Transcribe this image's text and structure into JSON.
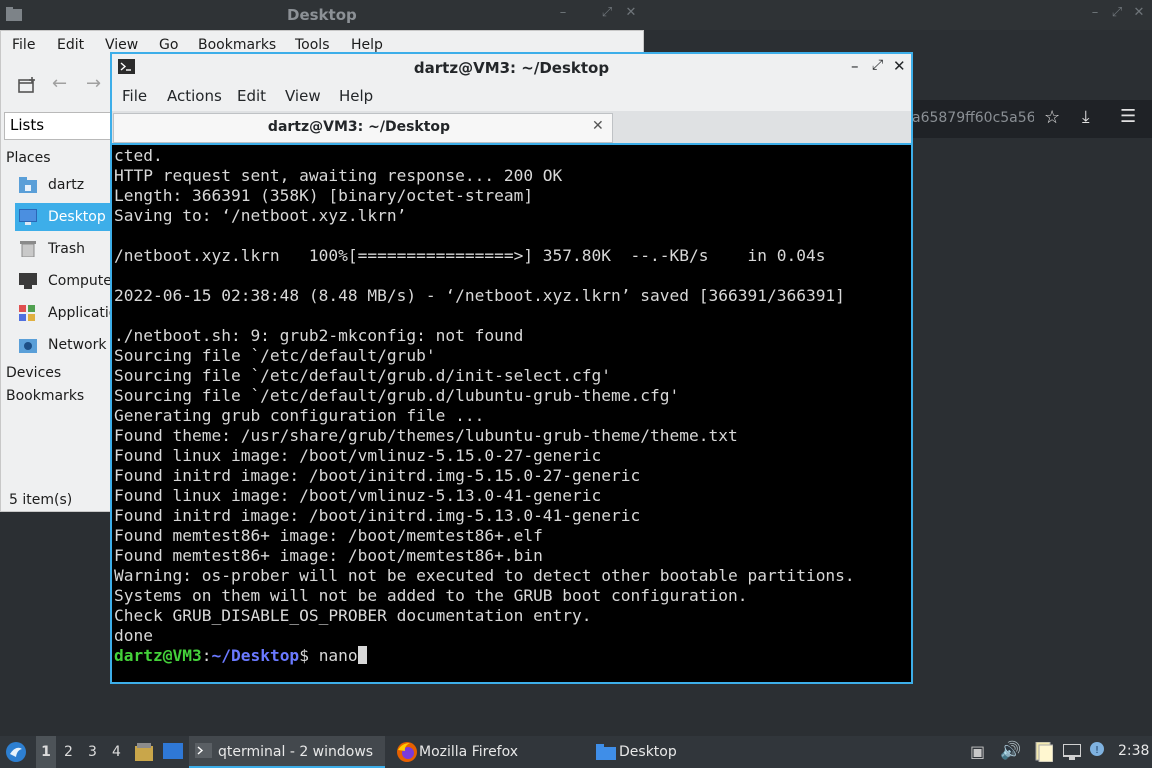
{
  "background_window": {
    "title": "Desktop"
  },
  "file_manager": {
    "menu": [
      "File",
      "Edit",
      "View",
      "Go",
      "Bookmarks",
      "Tools",
      "Help"
    ],
    "lists_label": "Lists",
    "places_header": "Places",
    "places": [
      {
        "label": "dartz",
        "icon": "home-folder-icon",
        "selected": false
      },
      {
        "label": "Desktop",
        "icon": "desktop-icon",
        "selected": true
      },
      {
        "label": "Trash",
        "icon": "trash-icon",
        "selected": false
      },
      {
        "label": "Computer",
        "icon": "computer-icon",
        "selected": false
      },
      {
        "label": "Applications",
        "icon": "applications-icon",
        "selected": false
      },
      {
        "label": "Network",
        "icon": "network-icon",
        "selected": false
      }
    ],
    "devices_header": "Devices",
    "bookmarks_header": "Bookmarks",
    "status": "5 item(s)"
  },
  "firefox_behind": {
    "url_fragment": "a65879ff60c5a56"
  },
  "terminal": {
    "title": "dartz@VM3: ~/Desktop",
    "menu": [
      "File",
      "Actions",
      "Edit",
      "View",
      "Help"
    ],
    "tab_title": "dartz@VM3: ~/Desktop",
    "lines": [
      "cted.",
      "HTTP request sent, awaiting response... 200 OK",
      "Length: 366391 (358K) [binary/octet-stream]",
      "Saving to: ‘/netboot.xyz.lkrn’",
      "",
      "/netboot.xyz.lkrn   100%[================>] 357.80K  --.-KB/s    in 0.04s",
      "",
      "2022-06-15 02:38:48 (8.48 MB/s) - ‘/netboot.xyz.lkrn’ saved [366391/366391]",
      "",
      "./netboot.sh: 9: grub2-mkconfig: not found",
      "Sourcing file `/etc/default/grub'",
      "Sourcing file `/etc/default/grub.d/init-select.cfg'",
      "Sourcing file `/etc/default/grub.d/lubuntu-grub-theme.cfg'",
      "Generating grub configuration file ...",
      "Found theme: /usr/share/grub/themes/lubuntu-grub-theme/theme.txt",
      "Found linux image: /boot/vmlinuz-5.15.0-27-generic",
      "Found initrd image: /boot/initrd.img-5.15.0-27-generic",
      "Found linux image: /boot/vmlinuz-5.13.0-41-generic",
      "Found initrd image: /boot/initrd.img-5.13.0-41-generic",
      "Found memtest86+ image: /boot/memtest86+.elf",
      "Found memtest86+ image: /boot/memtest86+.bin",
      "Warning: os-prober will not be executed to detect other bootable partitions.",
      "Systems on them will not be added to the GRUB boot configuration.",
      "Check GRUB_DISABLE_OS_PROBER documentation entry.",
      "done"
    ],
    "prompt_user": "dartz@VM3",
    "prompt_sep": ":",
    "prompt_path": "~/Desktop",
    "prompt_symbol": "$ ",
    "input": "nano"
  },
  "taskbar": {
    "workspaces": [
      "1",
      "2",
      "3",
      "4"
    ],
    "tasks": [
      {
        "label": "qterminal - 2 windows",
        "icon": "terminal-icon",
        "active": true
      },
      {
        "label": "Mozilla Firefox",
        "icon": "firefox-icon",
        "active": false
      },
      {
        "label": "Desktop",
        "icon": "folder-icon",
        "active": false
      }
    ],
    "clock": "2:38"
  }
}
